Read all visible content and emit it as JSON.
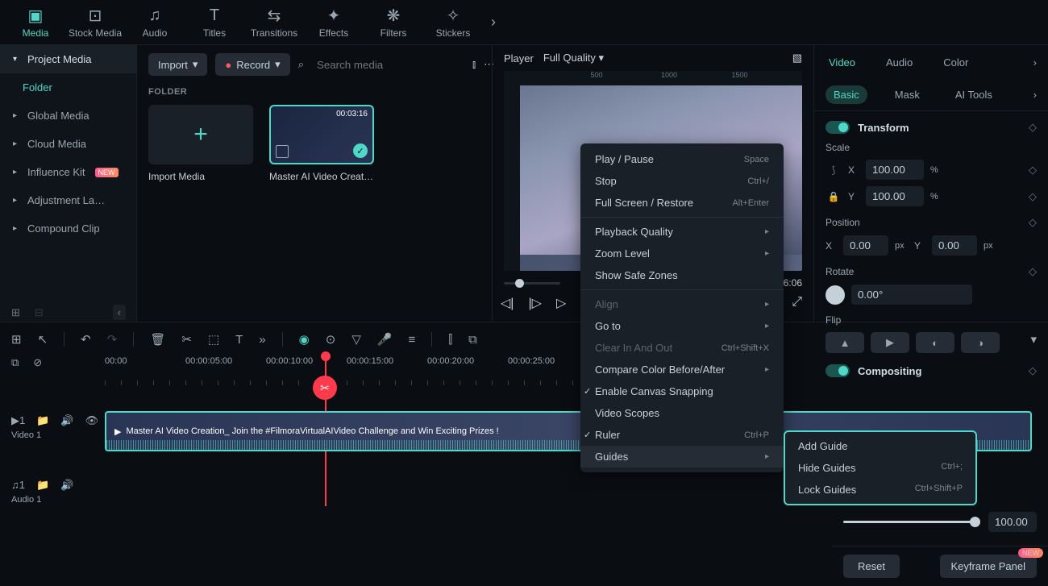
{
  "topbar": [
    {
      "icon": "▣",
      "label": "Media",
      "active": true
    },
    {
      "icon": "⊡",
      "label": "Stock Media"
    },
    {
      "icon": "♫",
      "label": "Audio"
    },
    {
      "icon": "T",
      "label": "Titles"
    },
    {
      "icon": "⇄",
      "label": "Transitions"
    },
    {
      "icon": "✦",
      "label": "Effects"
    },
    {
      "icon": "❋",
      "label": "Filters"
    },
    {
      "icon": "✧",
      "label": "Stickers"
    }
  ],
  "sidebar": {
    "header": "Project Media",
    "active": "Folder",
    "items": [
      "Global Media",
      "Cloud Media",
      "Influence Kit",
      "Adjustment La…",
      "Compound Clip"
    ],
    "newIndex": 2
  },
  "mediaBar": {
    "import": "Import",
    "record": "Record",
    "searchPlaceholder": "Search media"
  },
  "mediaSection": "FOLDER",
  "mediaCards": {
    "import": "Import Media",
    "clip": {
      "duration": "00:03:16",
      "title": "Master AI Video Creati…"
    }
  },
  "player": {
    "label": "Player",
    "quality": "Full Quality",
    "rulerMarks": [
      "500",
      "1000",
      "1500"
    ],
    "totalTime": ":16:06"
  },
  "contextMenu": {
    "items": [
      {
        "label": "Play / Pause",
        "shortcut": "Space"
      },
      {
        "label": "Stop",
        "shortcut": "Ctrl+/"
      },
      {
        "label": "Full Screen / Restore",
        "shortcut": "Alt+Enter"
      },
      {
        "div": true
      },
      {
        "label": "Playback Quality",
        "submenu": true
      },
      {
        "label": "Zoom Level",
        "submenu": true
      },
      {
        "label": "Show Safe Zones"
      },
      {
        "div": true
      },
      {
        "label": "Align",
        "submenu": true,
        "disabled": true
      },
      {
        "label": "Go to",
        "submenu": true
      },
      {
        "label": "Clear In And Out",
        "shortcut": "Ctrl+Shift+X",
        "disabled": true
      },
      {
        "label": "Compare Color Before/After",
        "submenu": true
      },
      {
        "label": "Enable Canvas Snapping",
        "checked": true
      },
      {
        "label": "Video Scopes"
      },
      {
        "label": "Ruler",
        "shortcut": "Ctrl+P",
        "checked": true
      },
      {
        "label": "Guides",
        "submenu": true,
        "highlight": true
      }
    ]
  },
  "guidesSub": [
    {
      "label": "Add Guide"
    },
    {
      "label": "Hide Guides",
      "shortcut": "Ctrl+;"
    },
    {
      "label": "Lock Guides",
      "shortcut": "Ctrl+Shift+P"
    }
  ],
  "props": {
    "tabs": [
      "Video",
      "Audio",
      "Color"
    ],
    "subtabs": [
      "Basic",
      "Mask",
      "AI Tools"
    ],
    "transform": "Transform",
    "scale": {
      "label": "Scale",
      "x": "100.00",
      "y": "100.00",
      "unit": "%"
    },
    "position": {
      "label": "Position",
      "x": "0.00",
      "y": "0.00",
      "unit": "px"
    },
    "rotate": {
      "label": "Rotate",
      "value": "0.00°"
    },
    "flip": "Flip",
    "compositing": "Compositing",
    "opacityValue": "100.00",
    "reset": "Reset",
    "keyframe": "Keyframe Panel",
    "new": "NEW"
  },
  "timeline": {
    "times": [
      "00:00",
      "00:00:05:00",
      "00:00:10:00",
      "00:00:15:00",
      "00:00:20:00",
      "00:00:25:00",
      "",
      "",
      ":00"
    ],
    "video": "Video 1",
    "audio": "Audio 1",
    "clipTitle": "Master AI Video Creation_ Join the #FilmoraVirtualAIVideo Challenge and Win Exciting Prizes !"
  }
}
